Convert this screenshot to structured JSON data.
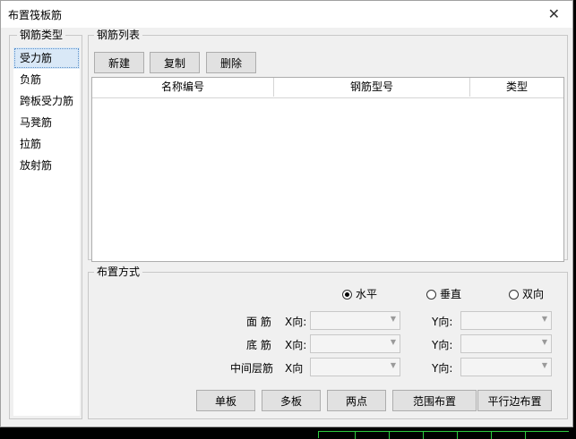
{
  "dialog": {
    "title": "布置筏板筋",
    "close_symbol": "✕"
  },
  "rebar_type": {
    "legend": "钢筋类型",
    "items": [
      "受力筋",
      "负筋",
      "跨板受力筋",
      "马凳筋",
      "拉筋",
      "放射筋"
    ],
    "selected": "受力筋"
  },
  "rebar_list": {
    "legend": "钢筋列表",
    "buttons": {
      "new": "新建",
      "copy": "复制",
      "delete": "删除"
    },
    "columns": [
      "名称编号",
      "钢筋型号",
      "类型"
    ]
  },
  "layout": {
    "legend": "布置方式",
    "orientation": {
      "horizontal": "水平",
      "vertical": "垂直",
      "both": "双向",
      "selected": "horizontal"
    },
    "rows": [
      {
        "label": "面 筋",
        "x_label": "X向:",
        "y_label": "Y向:"
      },
      {
        "label": "底 筋",
        "x_label": "X向:",
        "y_label": "Y向:"
      },
      {
        "label": "中间层筋",
        "x_label": "X向",
        "y_label": "Y向:"
      }
    ],
    "actions": {
      "single": "单板",
      "multi": "多板",
      "two_point": "两点",
      "range": "范围布置",
      "parallel": "平行边布置"
    }
  },
  "colors": {
    "accent_selection": "#d9e8f7",
    "status_line": "#2ecc40"
  }
}
